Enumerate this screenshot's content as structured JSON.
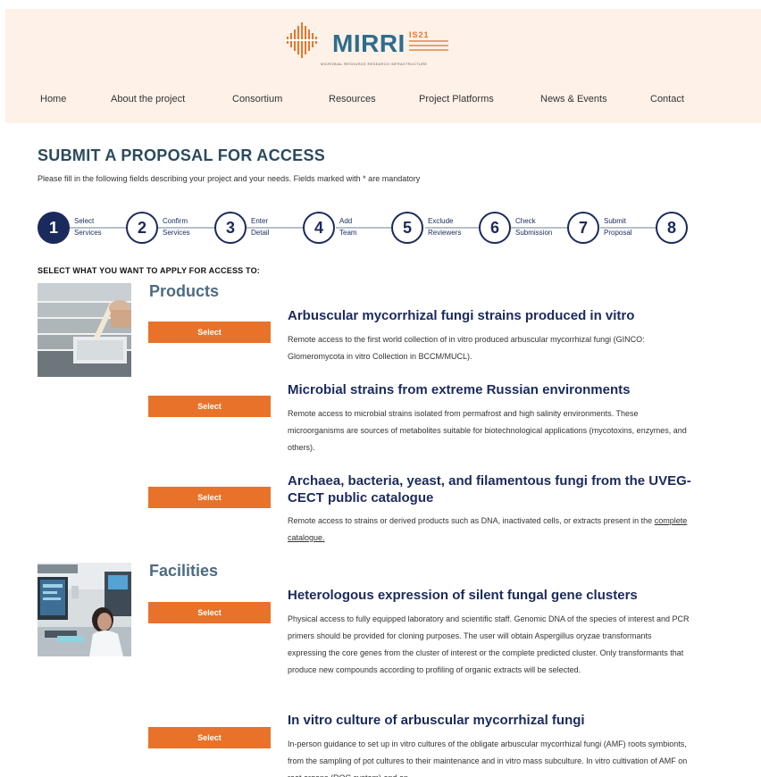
{
  "brand": {
    "name": "MIRRI",
    "badge": "IS21",
    "tagline": "MICROBIAL RESOURCE RESEARCH INFRASTRUCTURE",
    "accent": "#e8762b",
    "primary": "#2e6d8b"
  },
  "nav": {
    "items": [
      "Home",
      "About the project",
      "Consortium",
      "Resources",
      "Project Platforms",
      "News & Events",
      "Contact"
    ]
  },
  "page": {
    "title": "SUBMIT A PROPOSAL FOR ACCESS",
    "intro": "Please fill in the following fields describing your project and your needs. Fields marked with * are mandatory"
  },
  "stepper": {
    "steps": [
      {
        "number": "1",
        "line1": "Select",
        "line2": "Services",
        "active": true
      },
      {
        "number": "2",
        "line1": "Confirm",
        "line2": "Services",
        "active": false
      },
      {
        "number": "3",
        "line1": "Enter",
        "line2": "Detail",
        "active": false
      },
      {
        "number": "4",
        "line1": "Add",
        "line2": "Team",
        "active": false
      },
      {
        "number": "5",
        "line1": "Exclude",
        "line2": "Reviewers",
        "active": false
      },
      {
        "number": "6",
        "line1": "Check",
        "line2": "Submission",
        "active": false
      },
      {
        "number": "7",
        "line1": "Submit",
        "line2": "Proposal",
        "active": false
      },
      {
        "number": "8",
        "line1": "",
        "line2": "",
        "active": false
      }
    ]
  },
  "selection": {
    "heading": "SELECT WHAT YOU WANT TO APPLY FOR ACCESS TO:",
    "select_label": "Select",
    "categories": [
      {
        "title": "Products"
      },
      {
        "title": "Facilities"
      }
    ],
    "items": [
      {
        "title": "Arbuscular mycorrhizal fungi strains produced in vitro",
        "desc": "Remote access to the first world collection of in vitro produced arbuscular mycorrhizal fungi (GINCO: Glomeromycota in vitro Collection in BCCM/MUCL)."
      },
      {
        "title": "Microbial strains from extreme Russian environments",
        "desc": "Remote access to microbial strains isolated from permafrost and high salinity environments. These microorganisms are sources of metabolites suitable for biotechnological applications (mycotoxins, enzymes, and others)."
      },
      {
        "title": "Archaea, bacteria, yeast, and filamentous fungi from the UVEG-CECT public catalogue",
        "desc": "Remote access to strains or derived products such as DNA, inactivated cells, or extracts present in the",
        "link": "complete catalogue."
      },
      {
        "title": "Heterologous expression of silent fungal gene clusters",
        "desc": "Physical access to fully equipped laboratory and scientific staff. Genomic DNA of the species of interest and PCR primers should be provided for cloning purposes. The user will obtain Aspergillus oryzae transformants expressing the core genes from the cluster of interest or the complete predicted cluster. Only transformants that produce new compounds according to profiling of organic extracts will be selected."
      },
      {
        "title": "In vitro culture of arbuscular mycorrhizal fungi",
        "desc": "In-person guidance to set up in vitro cultures of the obligate arbuscular mycorrhizal fungi (AMF) roots symbionts, from the sampling of pot cultures to their maintenance and in vitro mass subculture. In vitro cultivation of AMF on root organs (ROC system) and on"
      }
    ]
  }
}
